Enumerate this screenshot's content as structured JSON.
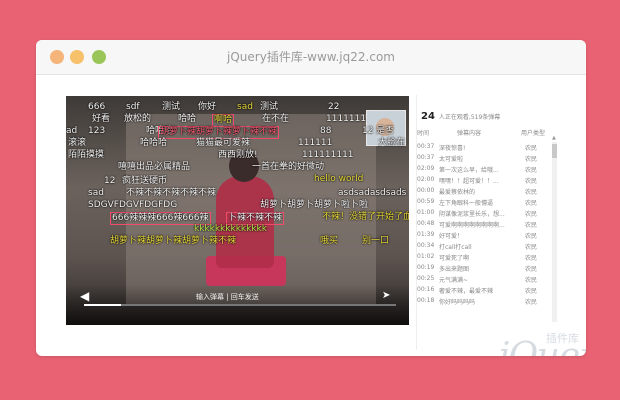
{
  "window": {
    "title": "jQuery插件库-www.jq22.com"
  },
  "player": {
    "send_text": "输入弹幕 | 回车发送",
    "progress_fraction": 0.12,
    "danmu": [
      {
        "text": "666",
        "row": 0
      },
      {
        "text": "sdf",
        "row": 0
      },
      {
        "text": "测试",
        "row": 0
      },
      {
        "text": "你好",
        "row": 0
      },
      {
        "text": "sad",
        "row": 0
      },
      {
        "text": "测试",
        "row": 0
      },
      {
        "text": "22",
        "row": 0
      },
      {
        "text": "好看",
        "row": 1
      },
      {
        "text": "放松的",
        "row": 1
      },
      {
        "text": "哈哈",
        "row": 1
      },
      {
        "text": "啊哈",
        "row": 1
      },
      {
        "text": "在不在",
        "row": 1
      },
      {
        "text": "1111111",
        "row": 1
      },
      {
        "text": "哈哈哈",
        "row": 2
      },
      {
        "text": "胡萝卜辣胡萝卜辣萝卜辣不辣",
        "row": 2
      },
      {
        "text": "88",
        "row": 2
      },
      {
        "text": "12",
        "row": 2
      },
      {
        "text": "是否",
        "row": 2
      },
      {
        "text": "ad",
        "row": 2
      },
      {
        "text": "123",
        "row": 2
      },
      {
        "text": "滚滚",
        "row": 3
      },
      {
        "text": "哈哈哈",
        "row": 3
      },
      {
        "text": "猫猫最可爱辣",
        "row": 3
      },
      {
        "text": "111111",
        "row": 3
      },
      {
        "text": "大脸在",
        "row": 3
      },
      {
        "text": "陌陌摸摸",
        "row": 4
      },
      {
        "text": "西西刚放!",
        "row": 4
      },
      {
        "text": "111111111",
        "row": 4
      },
      {
        "text": "嘻嘻出品必属精品",
        "row": 5
      },
      {
        "text": "一首在拳的好微动",
        "row": 5
      },
      {
        "text": "hello world",
        "row": 6
      },
      {
        "text": "疯狂送硬币",
        "row": 6
      },
      {
        "text": "sad",
        "row": 7
      },
      {
        "text": "不辣不辣不辣不辣不辣",
        "row": 7
      },
      {
        "text": "asdsadasdsads",
        "row": 7
      },
      {
        "text": "SDGVFDGVFDGFDG",
        "row": 8
      },
      {
        "text": "胡萝卜胡萝卜胡萝卜啦卜啦",
        "row": 8
      },
      {
        "text": "666辣辣辣666辣666辣",
        "row": 9
      },
      {
        "text": "卜辣不辣不辣",
        "row": 9
      },
      {
        "text": "不辣！没错了开始了血",
        "row": 9
      },
      {
        "text": "kkkkkkkkkkkkkk",
        "row": 10
      },
      {
        "text": "胡萝卜辣胡萝卜辣胡萝卜辣不辣",
        "row": 11
      },
      {
        "text": "哦买",
        "row": 11
      },
      {
        "text": "别一口",
        "row": 11
      },
      {
        "text": "12",
        "row": 6
      }
    ]
  },
  "side": {
    "count": "24",
    "count_text": "人正在观看,519条弹幕",
    "columns": [
      "时间",
      "弹幕内容",
      "用户类型"
    ],
    "rows": [
      {
        "time": "00:37",
        "content": "深夜惊喜!",
        "user": "农民"
      },
      {
        "time": "00:37",
        "content": "太可爱啦",
        "user": "农民"
      },
      {
        "time": "02:09",
        "content": "第一次这么早，给哦...",
        "user": "农民"
      },
      {
        "time": "02:00",
        "content": "嘿嘿！！超可爱！！...",
        "user": "农民"
      },
      {
        "time": "00:00",
        "content": "最爱蔡依林的",
        "user": "农民"
      },
      {
        "time": "00:59",
        "content": "左下角眼科一般懵逼",
        "user": "农民"
      },
      {
        "time": "01:00",
        "content": "阴谋像泥浆里长乐，想...",
        "user": "农民"
      },
      {
        "time": "00:48",
        "content": "可爱啊啊啊啊啊啊啊啊...",
        "user": "农民"
      },
      {
        "time": "01:39",
        "content": "好可爱！",
        "user": "农民"
      },
      {
        "time": "00:34",
        "content": "打call打call",
        "user": "农民"
      },
      {
        "time": "01:02",
        "content": "可爱死了啊",
        "user": "农民"
      },
      {
        "time": "00:19",
        "content": "多出来题图",
        "user": "农民"
      },
      {
        "time": "00:25",
        "content": "元气满满~",
        "user": "农民"
      },
      {
        "time": "00:16",
        "content": "奢爱不辣，最爱不辣",
        "user": "农民"
      },
      {
        "time": "00:18",
        "content": "你好吗吗吗吗",
        "user": "农民"
      }
    ]
  },
  "watermark": {
    "big": "jQuery",
    "small": "插件库"
  }
}
